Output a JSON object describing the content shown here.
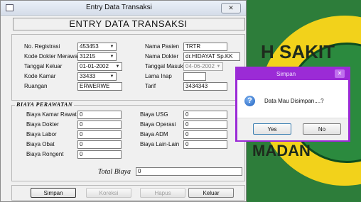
{
  "logo": {
    "text_top": "H SAKIT",
    "text_bottom": "MADAN"
  },
  "window": {
    "title": "Entry Data Transaksi",
    "close_glyph": "✕"
  },
  "heading": "ENTRY DATA TRANSAKSI",
  "form": {
    "no_registrasi": {
      "label": "No. Registrasi",
      "value": "453453"
    },
    "kode_dokter": {
      "label": "Kode Dokter Merawat",
      "value": "31215"
    },
    "tanggal_keluar": {
      "label": "Tanggal Keluar",
      "value": "01-01-2002"
    },
    "kode_kamar": {
      "label": "Kode Kamar",
      "value": "33433"
    },
    "ruangan": {
      "label": "Ruangan",
      "value": "ERWERWE"
    },
    "nama_pasien": {
      "label": "Nama Pasien",
      "value": "TRTR"
    },
    "nama_dokter": {
      "label": "Nama Dokter",
      "value": "dr.HIDAYAT Sp.KK"
    },
    "tanggal_masuk": {
      "label": "Tanggal Masuk",
      "value": "04-06-2002"
    },
    "lama_inap": {
      "label": "Lama Inap",
      "value": ""
    },
    "tarif": {
      "label": "Tarif",
      "value": "3434343"
    }
  },
  "biaya": {
    "title": "BIAYA PERAWATAN",
    "kamar_rawat": {
      "label": "Biaya Kamar Rawat",
      "value": "0"
    },
    "dokter": {
      "label": "Biaya Dokter",
      "value": "0"
    },
    "labor": {
      "label": "Biaya Labor",
      "value": "0"
    },
    "obat": {
      "label": "Biaya Obat",
      "value": "0"
    },
    "rongent": {
      "label": "Biaya Rongent",
      "value": "0"
    },
    "usg": {
      "label": "Biaya USG",
      "value": "0"
    },
    "operasi": {
      "label": "Biaya Operasi",
      "value": "0"
    },
    "adm": {
      "label": "Biaya ADM",
      "value": "0"
    },
    "lain_lain": {
      "label": "Biaya Lain-Lain",
      "value": "0"
    }
  },
  "total": {
    "label": "Total Biaya",
    "value": "0"
  },
  "buttons": {
    "simpan": "Simpan",
    "koreksi": "Koreksi",
    "hapus": "Hapus",
    "keluar": "Keluar"
  },
  "dialog": {
    "title": "Simpan",
    "close_glyph": "✕",
    "message": "Data Mau Disimpan....?",
    "yes": "Yes",
    "no": "No",
    "icon": "question-icon"
  },
  "colors": {
    "dialog_accent": "#9b2bd6",
    "logo_green": "#2d7d3a",
    "logo_yellow": "#f2d21b"
  }
}
